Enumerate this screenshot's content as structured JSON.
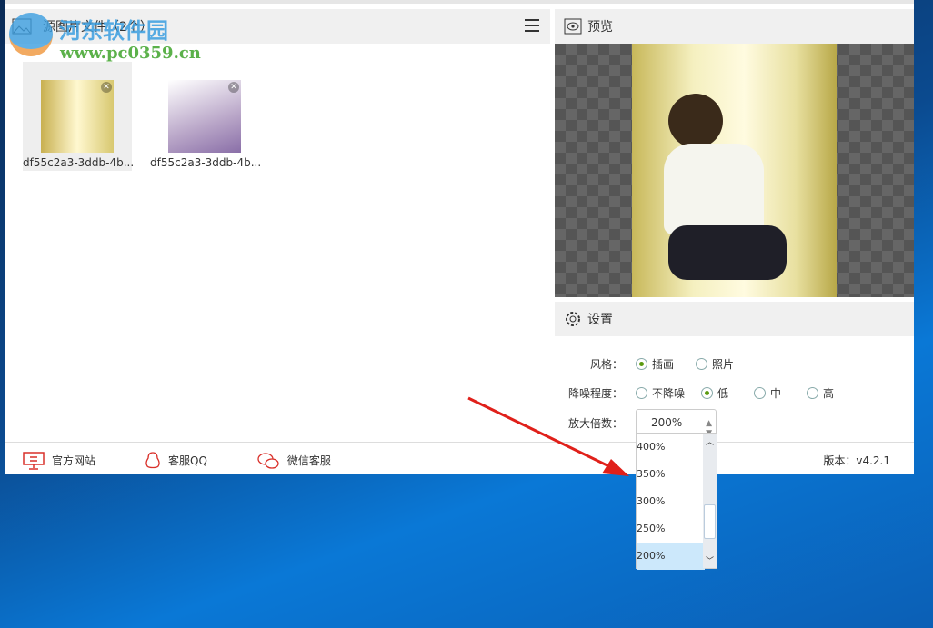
{
  "source_panel": {
    "title": "源图片文件（2个）",
    "files": [
      {
        "name": "df55c2a3-3ddb-4b..."
      },
      {
        "name": "df55c2a3-3ddb-4b..."
      }
    ]
  },
  "preview": {
    "title": "预览"
  },
  "settings": {
    "title": "设置",
    "style": {
      "label": "风格：",
      "options": [
        "插画",
        "照片"
      ],
      "selected": "插画"
    },
    "denoise": {
      "label": "降噪程度：",
      "options": [
        "不降噪",
        "低",
        "中",
        "高"
      ],
      "selected": "低"
    },
    "scale": {
      "label": "放大倍数：",
      "value": "200%",
      "options": [
        "400%",
        "350%",
        "300%",
        "250%",
        "200%"
      ]
    }
  },
  "footer": {
    "links": [
      "官方网站",
      "客服QQ",
      "微信客服"
    ],
    "version": "版本：v4.2.1"
  },
  "watermark": {
    "name": "河东软件园",
    "url": "www.pc0359.cn"
  },
  "colors": {
    "accent": "#d9302a",
    "radio_selected": "#5a9a10",
    "dropdown_selected": "#cce8fb"
  }
}
